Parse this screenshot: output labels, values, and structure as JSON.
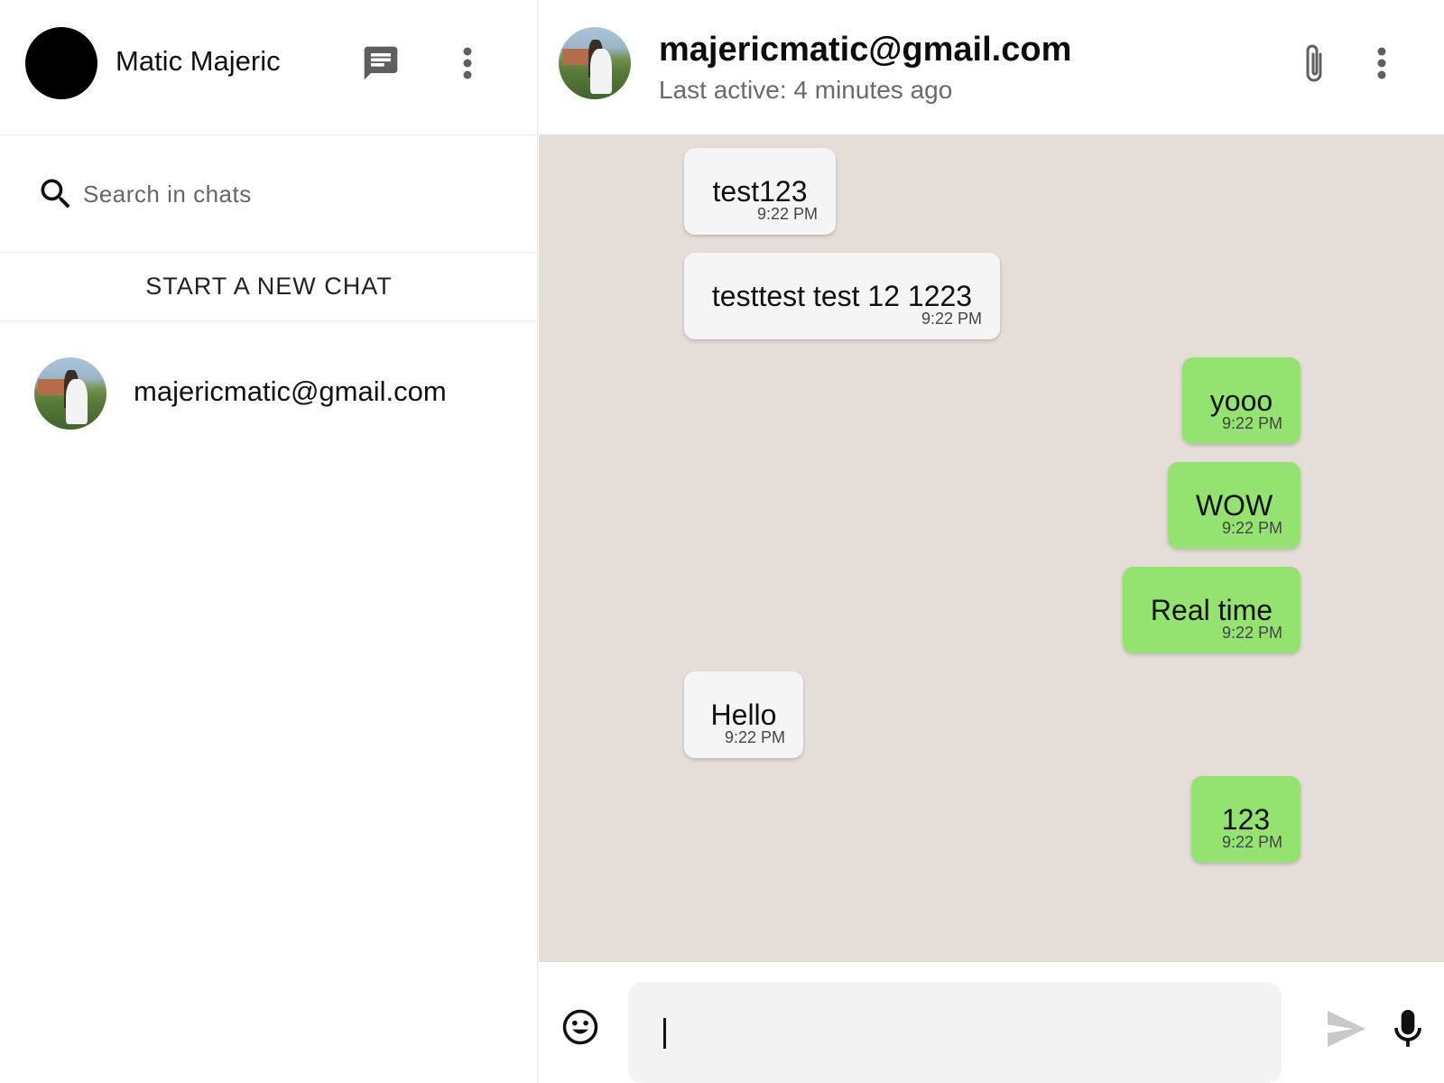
{
  "sidebar": {
    "user_name": "Matic Majeric",
    "search": {
      "placeholder": "Search in chats",
      "value": ""
    },
    "new_chat_label": "START A NEW CHAT",
    "chats": [
      {
        "name": "majericmatic@gmail.com"
      }
    ],
    "icons": [
      "avatar",
      "chat-icon",
      "more-vert-icon",
      "search-icon"
    ]
  },
  "conversation": {
    "title": "majericmatic@gmail.com",
    "status": "Last active: 4 minutes ago",
    "icons": [
      "attach-icon",
      "more-vert-icon"
    ],
    "messages": [
      {
        "text": "test123",
        "time": "9:22 PM",
        "direction": "incoming"
      },
      {
        "text": "testtest test 12 1223",
        "time": "9:22 PM",
        "direction": "incoming"
      },
      {
        "text": "yooo",
        "time": "9:22 PM",
        "direction": "outgoing"
      },
      {
        "text": "WOW",
        "time": "9:22 PM",
        "direction": "outgoing"
      },
      {
        "text": "Real time",
        "time": "9:22 PM",
        "direction": "outgoing"
      },
      {
        "text": "Hello",
        "time": "9:22 PM",
        "direction": "incoming"
      },
      {
        "text": "123",
        "time": "9:22 PM",
        "direction": "outgoing"
      }
    ]
  },
  "composer": {
    "value": "",
    "icons": [
      "emoji-icon",
      "send-icon",
      "mic-icon"
    ]
  },
  "colors": {
    "chat_background": "#e5ddd7",
    "incoming_bubble": "#f5f5f5",
    "outgoing_bubble": "#94e370",
    "icon": "#5f5f5f"
  }
}
